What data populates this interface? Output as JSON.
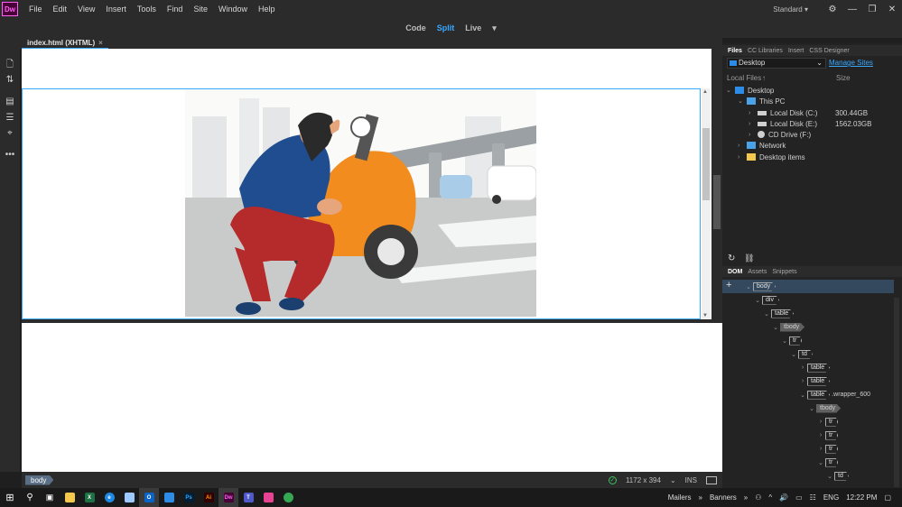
{
  "app": {
    "logo": "Dw",
    "menu": [
      "File",
      "Edit",
      "View",
      "Insert",
      "Tools",
      "Find",
      "Site",
      "Window",
      "Help"
    ],
    "workspace": "Standard",
    "window_controls": {
      "minimize": "—",
      "restore": "❐",
      "close": "✕"
    }
  },
  "view_toolbar": {
    "code": "Code",
    "split": "Split",
    "live": "Live",
    "dropdown": "▾"
  },
  "document": {
    "tab_label": "index.html (XHTML)",
    "tab_close": "×"
  },
  "status_bar": {
    "tag": "body",
    "dimensions": "1172 x 394",
    "dimensions_arrow": "⌄",
    "mode": "INS",
    "ok_symbol": "✓"
  },
  "files_panel": {
    "tabs": [
      "Files",
      "CC Libraries",
      "Insert",
      "CSS Designer"
    ],
    "location": "Desktop",
    "manage_sites": "Manage Sites",
    "col_local": "Local Files",
    "col_size": "Size",
    "sort_arrow": "↑",
    "tree": [
      {
        "name": "Desktop",
        "size": ""
      },
      {
        "name": "This PC",
        "size": ""
      },
      {
        "name": "Local Disk (C:)",
        "size": "300.44GB"
      },
      {
        "name": "Local Disk (E:)",
        "size": "1562.03GB"
      },
      {
        "name": "CD Drive (F:)",
        "size": ""
      },
      {
        "name": "Network",
        "size": ""
      },
      {
        "name": "Desktop items",
        "size": ""
      }
    ],
    "refresh": "↻",
    "connect": "⛓"
  },
  "dom_panel": {
    "tabs": [
      "DOM",
      "Assets",
      "Snippets"
    ],
    "add": "+",
    "nodes": [
      {
        "tag": "body",
        "class": ""
      },
      {
        "tag": "div",
        "class": ""
      },
      {
        "tag": "table",
        "class": ""
      },
      {
        "tag": "tbody",
        "class": ""
      },
      {
        "tag": "tr",
        "class": ""
      },
      {
        "tag": "td",
        "class": ""
      },
      {
        "tag": "table",
        "class": ""
      },
      {
        "tag": "table",
        "class": ""
      },
      {
        "tag": "table",
        "class": ".wrapper_600"
      },
      {
        "tag": "tbody",
        "class": ""
      },
      {
        "tag": "tr",
        "class": ""
      },
      {
        "tag": "tr",
        "class": ""
      },
      {
        "tag": "tr",
        "class": ""
      },
      {
        "tag": "tr",
        "class": ""
      },
      {
        "tag": "td",
        "class": ""
      }
    ]
  },
  "taskbar": {
    "mailers": "Mailers",
    "banners": "Banners",
    "chevron": "»",
    "lang": "ENG",
    "time": "12:22 PM"
  },
  "colors": {
    "accent": "#3aa8ff",
    "dw_brand": "#ff61f6",
    "scooter": "#f28c1e",
    "shirt": "#1f4d8f",
    "pants": "#b52a2a"
  }
}
